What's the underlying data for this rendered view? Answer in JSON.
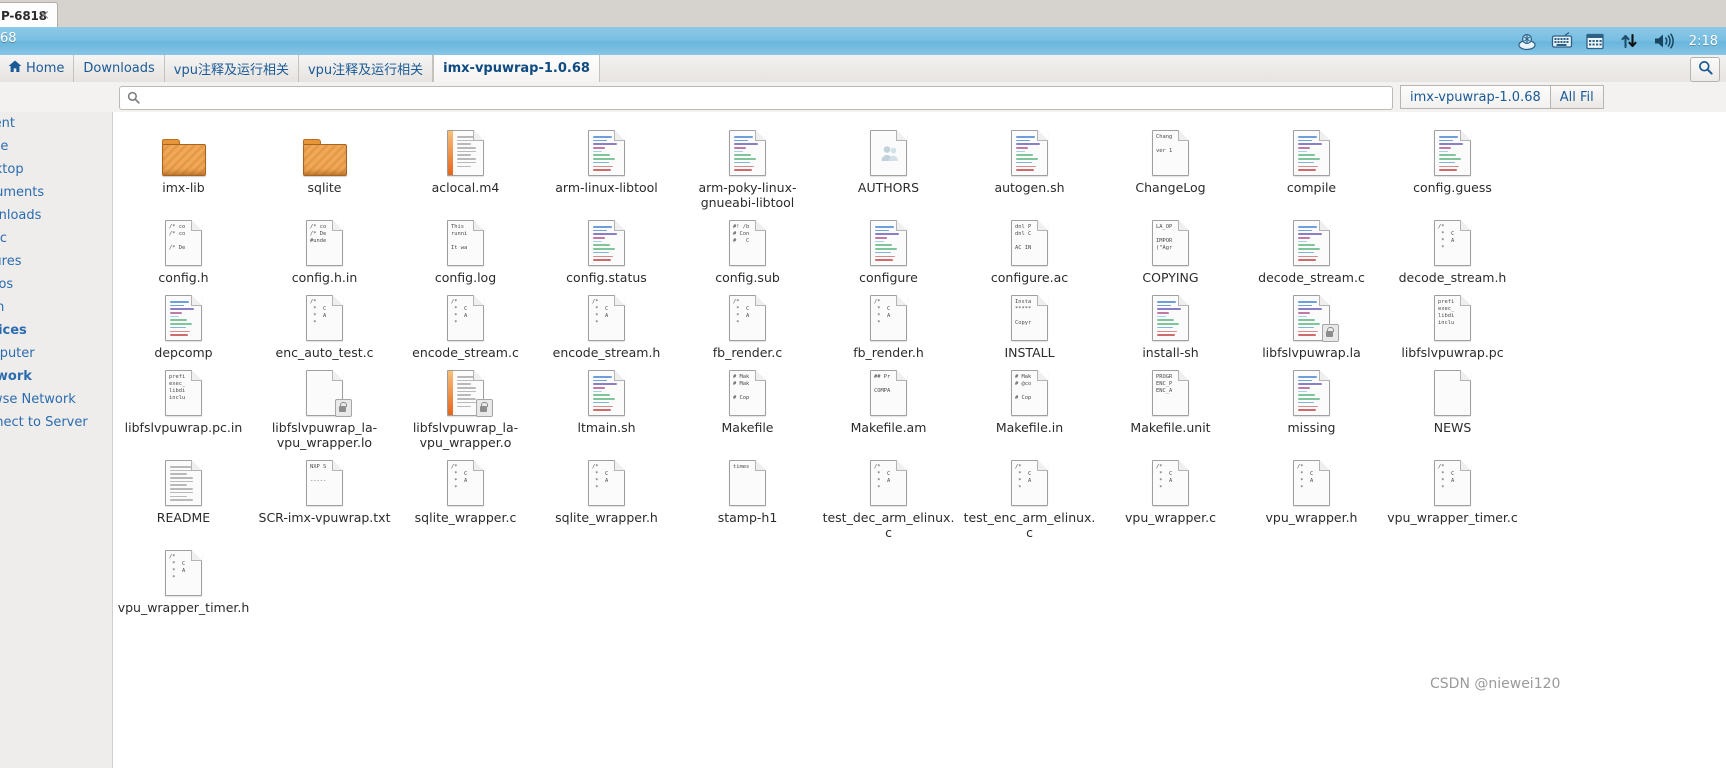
{
  "window": {
    "tab_label": "P-6818",
    "close_glyph": "×"
  },
  "panel": {
    "title": "68",
    "clock": "2:18",
    "tray_icons": [
      "bluetooth-icon",
      "keyboard-indicator-icon",
      "calendar-icon",
      "network-icon",
      "volume-icon"
    ]
  },
  "pathbar": {
    "crumbs": [
      {
        "label": "Home",
        "icon": "home-icon",
        "active": false
      },
      {
        "label": "Downloads",
        "icon": "",
        "active": false
      },
      {
        "label": "vpu注释及运行相关",
        "icon": "",
        "active": false
      },
      {
        "label": "vpu注释及运行相关",
        "icon": "",
        "active": false
      },
      {
        "label": "imx-vpuwrap-1.0.68",
        "icon": "",
        "active": true
      }
    ],
    "search_button": "search-icon"
  },
  "search": {
    "value": "",
    "placeholder": "",
    "icon": "search-icon",
    "scopes": [
      {
        "label": "imx-vpuwrap-1.0.68",
        "selected": true
      },
      {
        "label": "All Fil",
        "selected": false
      }
    ]
  },
  "sidebar": {
    "items": [
      {
        "label": "Recent",
        "bold": false
      },
      {
        "label": "Home",
        "bold": false
      },
      {
        "label": "Desktop",
        "bold": false
      },
      {
        "label": "Documents",
        "bold": false
      },
      {
        "label": "Downloads",
        "bold": false
      },
      {
        "label": "Music",
        "bold": false
      },
      {
        "label": "Pictures",
        "bold": false
      },
      {
        "label": "Videos",
        "bold": false
      },
      {
        "label": "Trash",
        "bold": false
      },
      {
        "label": "Devices",
        "bold": true
      },
      {
        "label": "Computer",
        "bold": false
      },
      {
        "label": "Network",
        "bold": true
      },
      {
        "label": "Browse Network",
        "bold": false
      },
      {
        "label": "Connect to Server",
        "bold": false
      }
    ]
  },
  "files": [
    {
      "name": "imx-lib",
      "type": "folder"
    },
    {
      "name": "sqlite",
      "type": "folder"
    },
    {
      "name": "aclocal.m4",
      "type": "doc-stripe-lines"
    },
    {
      "name": "arm-linux-libtool",
      "type": "doc-code-lines"
    },
    {
      "name": "arm-poky-linux-gnueabi-libtool",
      "type": "doc-code-lines"
    },
    {
      "name": "AUTHORS",
      "type": "doc-people"
    },
    {
      "name": "autogen.sh",
      "type": "doc-code-lines"
    },
    {
      "name": "ChangeLog",
      "type": "doc-text",
      "preview": "Chang\n\nver 1"
    },
    {
      "name": "compile",
      "type": "doc-code-lines"
    },
    {
      "name": "config.guess",
      "type": "doc-code-lines"
    },
    {
      "name": "config.h",
      "type": "doc-text",
      "preview": "/* co\n/* co\n\n/* De"
    },
    {
      "name": "config.h.in",
      "type": "doc-text",
      "preview": "/* co\n/* De\n#unde"
    },
    {
      "name": "config.log",
      "type": "doc-text",
      "preview": "This\nrunni\n\nIt wa"
    },
    {
      "name": "config.status",
      "type": "doc-code-lines"
    },
    {
      "name": "config.sub",
      "type": "doc-text",
      "preview": "#! /b\n# Con\n#   C"
    },
    {
      "name": "configure",
      "type": "doc-code-lines"
    },
    {
      "name": "configure.ac",
      "type": "doc-text",
      "preview": "dnl P\ndnl C\n\nAC IN"
    },
    {
      "name": "COPYING",
      "type": "doc-text",
      "preview": "LA_OP\n\nIMPOR\n(\"Agr"
    },
    {
      "name": "decode_stream.c",
      "type": "doc-code-lines"
    },
    {
      "name": "decode_stream.h",
      "type": "doc-text",
      "preview": "/*\n *  C\n *  A\n *"
    },
    {
      "name": "depcomp",
      "type": "doc-code-lines"
    },
    {
      "name": "enc_auto_test.c",
      "type": "doc-text",
      "preview": "/*\n *  C\n *  A\n *"
    },
    {
      "name": "encode_stream.c",
      "type": "doc-text",
      "preview": "/*\n *  C\n *  A\n *"
    },
    {
      "name": "encode_stream.h",
      "type": "doc-text",
      "preview": "/*\n *  C\n *  A\n *"
    },
    {
      "name": "fb_render.c",
      "type": "doc-text",
      "preview": "/*\n *  C\n *  A\n *"
    },
    {
      "name": "fb_render.h",
      "type": "doc-text",
      "preview": "/*\n *  C\n *  A\n *"
    },
    {
      "name": "INSTALL",
      "type": "doc-text",
      "preview": "Insta\n*****\n\nCopyr"
    },
    {
      "name": "install-sh",
      "type": "doc-code-lines"
    },
    {
      "name": "libfslvpuwrap.la",
      "type": "doc-code-lines-lock"
    },
    {
      "name": "libfslvpuwrap.pc",
      "type": "doc-text",
      "preview": "prefi\nexec_\nlibdi\ninclu"
    },
    {
      "name": "libfslvpuwrap.pc.in",
      "type": "doc-text",
      "preview": "prefi\nexec_\nlibdi\ninclu"
    },
    {
      "name": "libfslvpuwrap_la-vpu_wrapper.lo",
      "type": "doc-blank-lock"
    },
    {
      "name": "libfslvpuwrap_la-vpu_wrapper.o",
      "type": "doc-stripe-lock"
    },
    {
      "name": "ltmain.sh",
      "type": "doc-code-lines"
    },
    {
      "name": "Makefile",
      "type": "doc-text",
      "preview": "# Mak\n# Mak\n\n# Cop"
    },
    {
      "name": "Makefile.am",
      "type": "doc-text",
      "preview": "## Pr\n\nCOMPA"
    },
    {
      "name": "Makefile.in",
      "type": "doc-text",
      "preview": "# Mak\n# @co\n\n# Cop"
    },
    {
      "name": "Makefile.unit",
      "type": "doc-text",
      "preview": "PROGR\nENC_P\nENC_A"
    },
    {
      "name": "missing",
      "type": "doc-code-lines"
    },
    {
      "name": "NEWS",
      "type": "doc-blank"
    },
    {
      "name": "README",
      "type": "doc-lines-plain"
    },
    {
      "name": "SCR-imx-vpuwrap.txt",
      "type": "doc-text",
      "preview": "NXP S\n\n-----"
    },
    {
      "name": "sqlite_wrapper.c",
      "type": "doc-text",
      "preview": "/*\n *  C\n *  A\n *"
    },
    {
      "name": "sqlite_wrapper.h",
      "type": "doc-text",
      "preview": "/*\n *  C\n *  A\n *"
    },
    {
      "name": "stamp-h1",
      "type": "doc-text",
      "preview": "times"
    },
    {
      "name": "test_dec_arm_elinux.c",
      "type": "doc-text",
      "preview": "/*\n *  C\n *  A\n *"
    },
    {
      "name": "test_enc_arm_elinux.c",
      "type": "doc-text",
      "preview": "/*\n *  C\n *  A\n *"
    },
    {
      "name": "vpu_wrapper.c",
      "type": "doc-text",
      "preview": "/*\n *  C\n *  A\n *"
    },
    {
      "name": "vpu_wrapper.h",
      "type": "doc-text",
      "preview": "/*\n *  C\n *  A\n *"
    },
    {
      "name": "vpu_wrapper_timer.c",
      "type": "doc-text",
      "preview": "/*\n *  C\n *  A\n *"
    },
    {
      "name": "vpu_wrapper_timer.h",
      "type": "doc-text",
      "preview": "/*\n *  C\n *  A\n *"
    }
  ],
  "watermark": "CSDN @niewei120"
}
